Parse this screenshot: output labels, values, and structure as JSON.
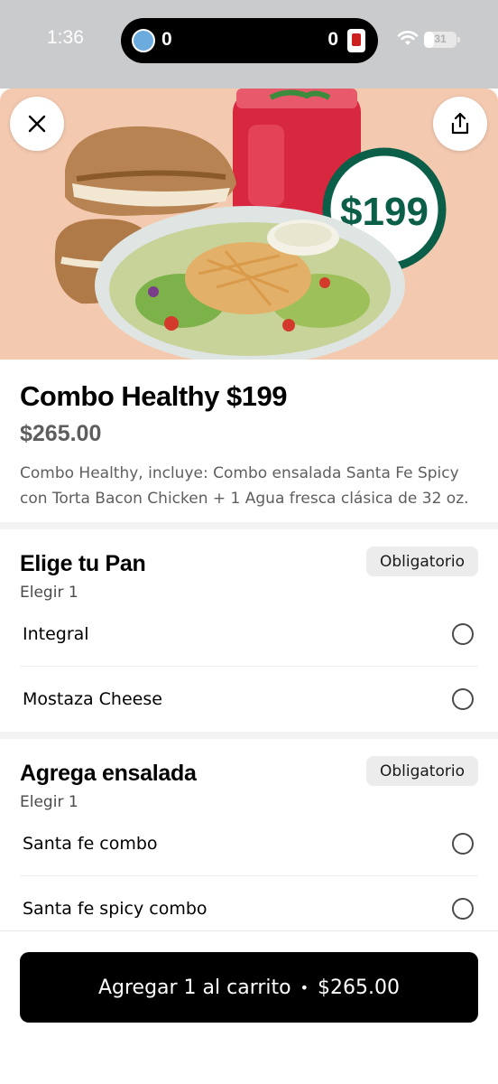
{
  "status_bar": {
    "time": "1:36",
    "score_home": "0",
    "score_away": "0",
    "battery": "31",
    "battery_level": 0.31
  },
  "hero": {
    "promo_price": "$199",
    "close_icon": "close-icon",
    "share_icon": "share-icon"
  },
  "product": {
    "title": "Combo Healthy $199",
    "price": "$265.00",
    "description": "Combo Healthy, incluye: Combo ensalada Santa Fe Spicy con Torta Bacon Chicken + 1 Agua fresca clásica de 32 oz."
  },
  "sections": [
    {
      "title": "Elige tu Pan",
      "subtitle": "Elegir 1",
      "badge": "Obligatorio",
      "options": [
        {
          "label": "Integral"
        },
        {
          "label": "Mostaza Cheese"
        }
      ]
    },
    {
      "title": "Agrega ensalada",
      "subtitle": "Elegir 1",
      "badge": "Obligatorio",
      "options": [
        {
          "label": "Santa fe combo"
        },
        {
          "label": "Santa fe spicy combo"
        }
      ]
    }
  ],
  "cart": {
    "label": "Agregar 1 al carrito",
    "separator": "•",
    "price": "$265.00"
  },
  "colors": {
    "brand_green": "#0b5e48",
    "hero_background": "#f3c9b0",
    "button_black": "#000000"
  }
}
